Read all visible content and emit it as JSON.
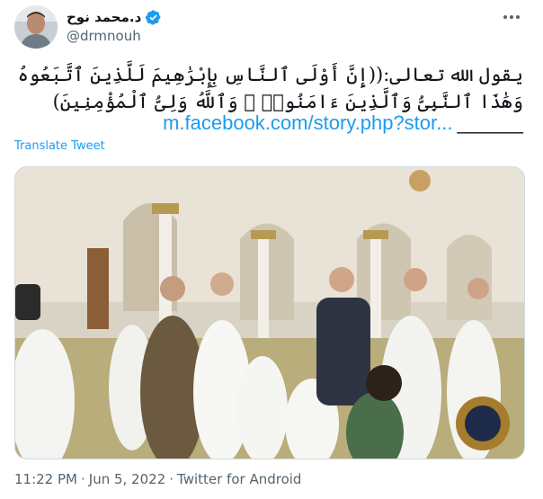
{
  "author": {
    "name": "د.محمد نوح",
    "handle": "@drmnouh",
    "verified": true
  },
  "tweet": {
    "text": "يقول الله تعالى:((إِنَّ أَوْلَى ٱلنَّاسِ بِإِبْرَٰهِيمَ لَلَّذِينَ ٱتَّبَعُوهُ وَهَٰذَا ٱلنَّبِىُّ وَٱلَّذِينَ ءَامَنُوا۟ ۗ وَٱللَّهُ وَلِىُّ ٱلْمُؤْمِنِينَ)",
    "link": "m.facebook.com/story.php?stor...",
    "underscores": "______",
    "translate_label": "Translate Tweet"
  },
  "meta": {
    "time": "11:22 PM",
    "sep1": "·",
    "date": "Jun 5, 2022",
    "sep2": "·",
    "source": "Twitter for Android"
  },
  "icons": {
    "more": "more-dots-icon",
    "verified": "verified-badge-icon"
  },
  "colors": {
    "accent": "#1d9bf0",
    "text": "#0f1419",
    "secondary": "#536471"
  }
}
